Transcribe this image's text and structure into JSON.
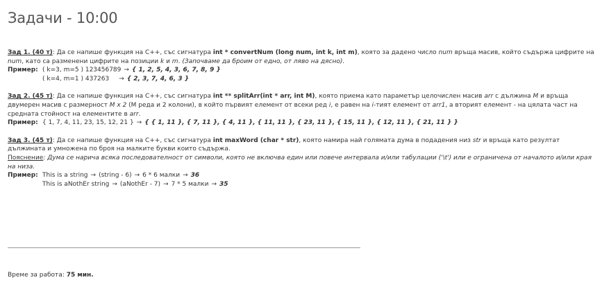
{
  "title": "Задачи - 10:00",
  "problems": [
    {
      "label": "Зад 1. (40 т)",
      "text_1": ": Да се напише функция на C++, със сигнатура ",
      "signature": "int * convertNum (long num, int k, int m)",
      "text_2": ", която за дадено число ",
      "var_1": "num",
      "text_3": " връща масив, който съдържа цифрите на ",
      "var_2": "num",
      "text_4": ", като са разменени цифрите на позиции ",
      "var_3": "k",
      "text_5": " и ",
      "var_4": "m",
      "text_6": ". ",
      "note": "(Започваме да броим от едно, от ляво на дясно).",
      "example_label": "Пример:",
      "examples": [
        {
          "input": "( k=3, m=5 ) 123456789",
          "arrow": "→",
          "result": "{ 1, 2, 5, 4, 3, 6, 7, 8, 9 }"
        },
        {
          "input": "( k=4, m=1 ) 437263",
          "arrow": "→",
          "result": "{ 2, 3, 7, 4, 6, 3 }"
        }
      ]
    },
    {
      "label": "Зад 2. (45 т)",
      "text_1": ": Да се напише функция на C++, със сигнатура ",
      "signature": "int ** splitArr(int * arr, int M)",
      "text_2": ", която приема като параметър целочислен масив ",
      "var_1": "arr",
      "text_3": " с дължина ",
      "var_2": "M",
      "text_4": " и връща двумерен масив с размерност ",
      "var_3": "M x 2",
      "text_5": " (M реда и 2 колони), в който първият елемент от всеки ред ",
      "var_4": "i",
      "text_6": ", е равен на ",
      "var_5": "i",
      "text_7": "-тият елемент от ",
      "var_6": "arr1",
      "text_8": ", а вторият елемент - на цялата част на средната стойност на елементите в ",
      "var_7": "arr",
      "text_9": ".",
      "example_label": "Пример:",
      "examples": [
        {
          "input": "{ 1, 7, 4, 11, 23, 15, 12, 21 }",
          "arrow": "→",
          "result": "{ { 1, 11 }, { 7, 11 }, { 4, 11 }, { 11, 11 }, { 23, 11 }, { 15, 11 }, { 12, 11 }, { 21, 11 } }"
        }
      ]
    },
    {
      "label": "Зад 3. (45 т)",
      "text_1": ": Да се напише функция на C++, със сигнатура ",
      "signature": "int maxWord (char * str)",
      "text_2": ", която намира най голямата дума в подадения низ ",
      "var_1": "str",
      "text_3": " и връща като резултат дължината и умножена по броя на малките букви които съдържа.",
      "explain_label": "Пояснение",
      "explain_text": ": Дума се нарича всяка последователност от символи, която не включва един или повече интервала и/или табулации ('\\t') или е ограничена от началото и/или края на низа.",
      "example_label": "Пример:",
      "examples": [
        {
          "input": "This is a string",
          "arrow_1": "→",
          "mid_1": "(string - 6)",
          "arrow_2": "→",
          "mid_2": "6 * 6 малки",
          "arrow_3": "→",
          "result": "36"
        },
        {
          "input": "This is aNothEr string",
          "arrow_1": "→",
          "mid_1": "(aNothEr - 7)",
          "arrow_2": "→",
          "mid_2": "7 * 5 малки",
          "arrow_3": "→",
          "result": "35"
        }
      ]
    }
  ],
  "footer": {
    "label": "Време за работа: ",
    "value": "75 мин."
  }
}
